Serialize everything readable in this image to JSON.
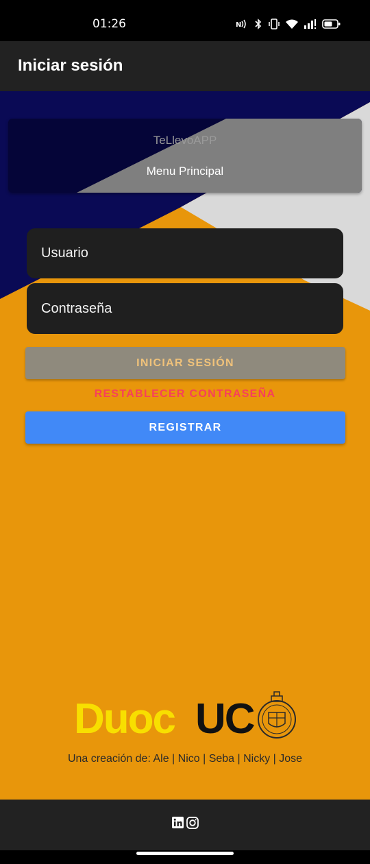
{
  "status_bar": {
    "time": "01:26",
    "icons": [
      "nfc-icon",
      "bluetooth-icon",
      "vibrate-icon",
      "wifi-icon",
      "signal-icon",
      "battery-icon"
    ]
  },
  "app_bar": {
    "title": "Iniciar sesión"
  },
  "header_card": {
    "app_name": "TeLlevoAPP",
    "subtitle": "Menu Principal"
  },
  "form": {
    "username_placeholder": "Usuario",
    "password_placeholder": "Contraseña",
    "login_button": "INICIAR SESIÓN",
    "reset_password_button": "RESTABLECER CONTRASEÑA",
    "register_button": "REGISTRAR"
  },
  "logo": {
    "duoc": "Duoc",
    "uc": "UC"
  },
  "credits": "Una creación de: Ale | Nico | Seba | Nicky | Jose",
  "footer": {
    "icons": [
      "linkedin-icon",
      "instagram-icon"
    ]
  },
  "colors": {
    "background": "#e8960b",
    "navy": "#0a0a55",
    "light_gray": "#d9d9d9",
    "card_gray": "#7f7f7f",
    "field_bg": "#1f1f1f",
    "login_btn": "#8f8a7d",
    "reset_text": "#f7405a",
    "register_btn": "#4189f7",
    "logo_yellow": "#f8df00"
  }
}
